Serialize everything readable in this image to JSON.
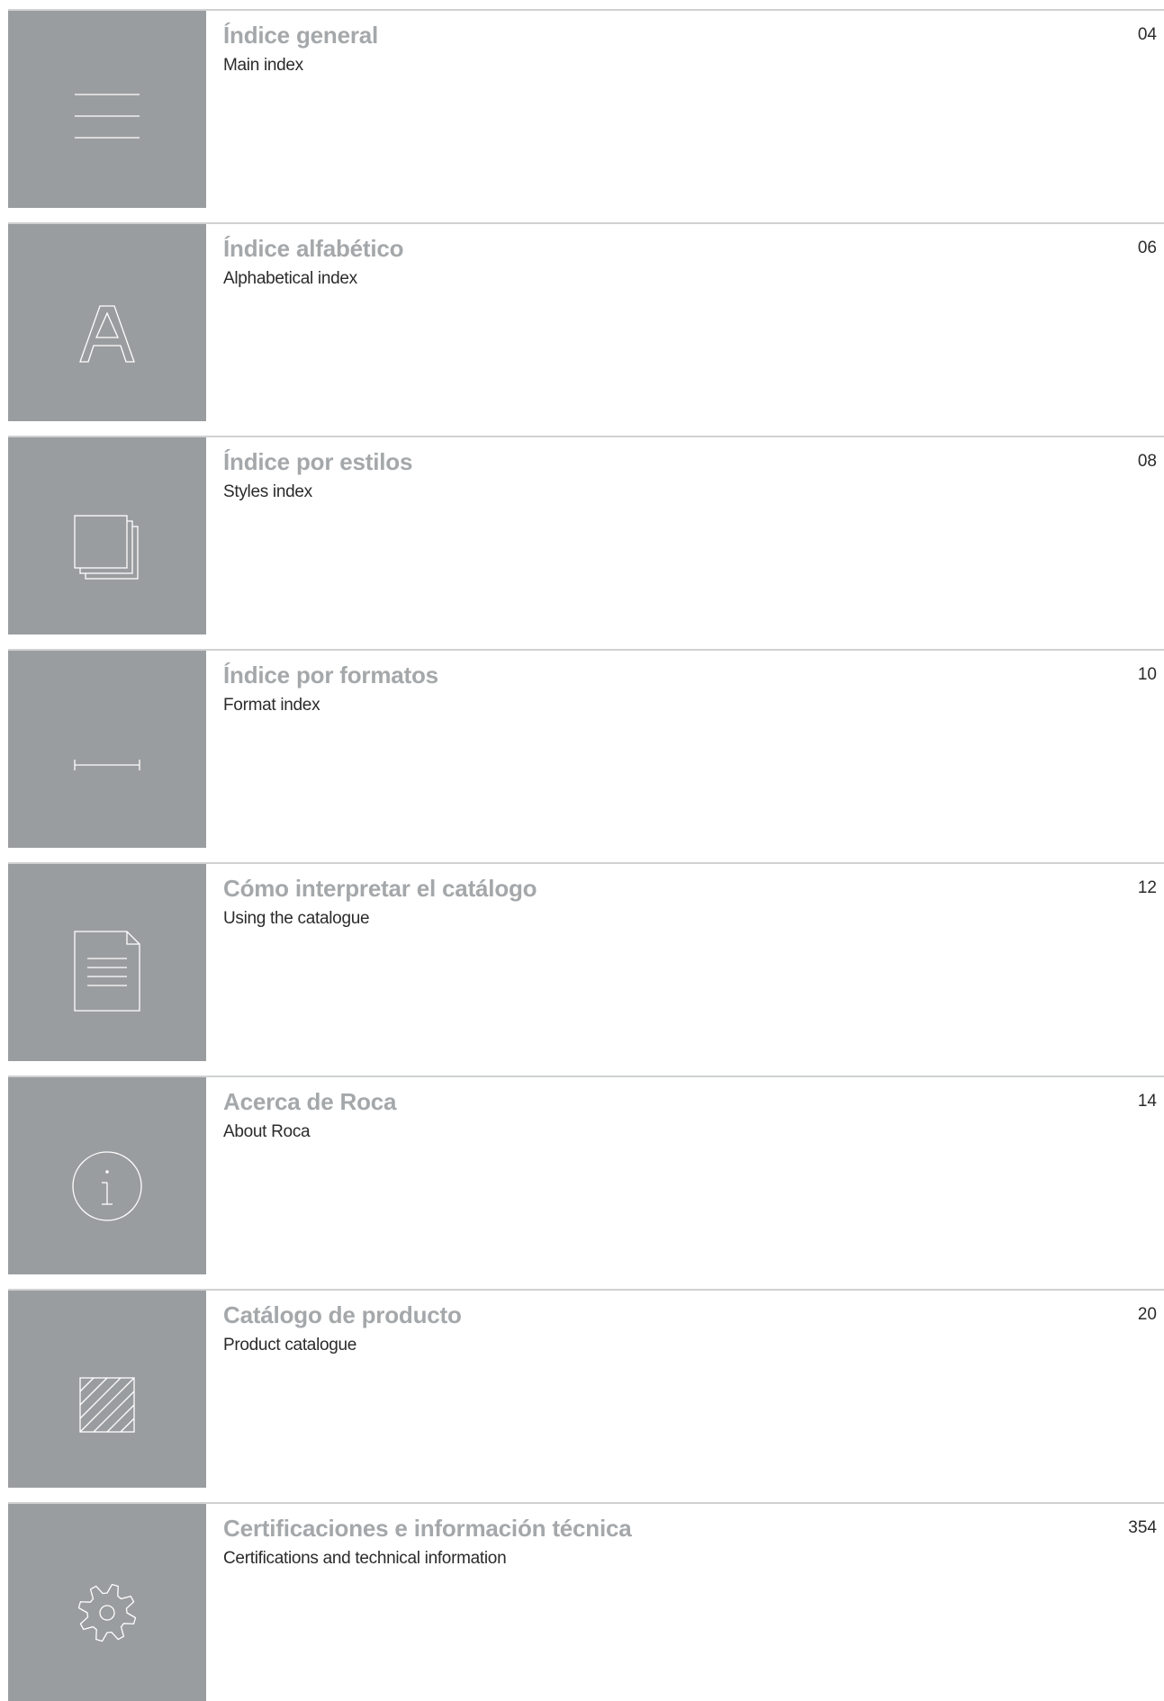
{
  "entries": [
    {
      "title": "Índice general",
      "subtitle": "Main index",
      "page": "04",
      "icon": "menu-lines-icon"
    },
    {
      "title": "Índice alfabético",
      "subtitle": "Alphabetical index",
      "page": "06",
      "icon": "letter-a-icon"
    },
    {
      "title": "Índice por estilos",
      "subtitle": "Styles index",
      "page": "08",
      "icon": "stacked-squares-icon"
    },
    {
      "title": "Índice por formatos",
      "subtitle": "Format index",
      "page": "10",
      "icon": "dimension-line-icon"
    },
    {
      "title": "Cómo interpretar el catálogo",
      "subtitle": "Using the catalogue",
      "page": "12",
      "icon": "document-icon"
    },
    {
      "title": "Acerca de Roca",
      "subtitle": "About Roca",
      "page": "14",
      "icon": "info-circle-icon"
    },
    {
      "title": "Catálogo de producto",
      "subtitle": "Product catalogue",
      "page": "20",
      "icon": "hatched-square-icon"
    },
    {
      "title": "Certificaciones e información técnica",
      "subtitle": "Certifications and technical information",
      "page": "354",
      "icon": "gear-icon"
    }
  ],
  "colors": {
    "tile": "#9a9d9f",
    "title": "#a5a8aa",
    "text": "#2b2b2b",
    "rule": "#cfd1d2",
    "icon_stroke": "#ffffff"
  }
}
